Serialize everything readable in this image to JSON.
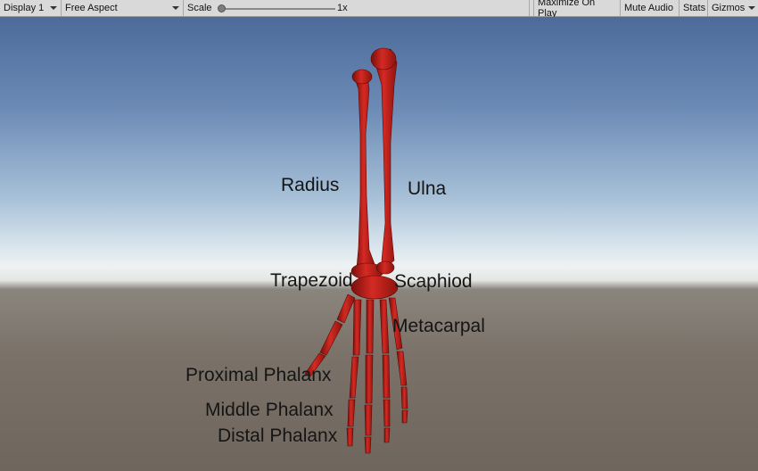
{
  "toolbar": {
    "display": "Display 1",
    "aspect": "Free Aspect",
    "scale_label": "Scale",
    "scale_value": "1x",
    "maximize": "Maximize On Play",
    "mute": "Mute Audio",
    "stats": "Stats",
    "gizmos": "Gizmos"
  },
  "labels": {
    "radius": "Radius",
    "ulna": "Ulna",
    "trapezoid": "Trapezoid",
    "scaphiod": "Scaphiod",
    "metacarpal": "Metacarpal",
    "proximal": "Proximal Phalanx",
    "middle": "Middle Phalanx",
    "distal": "Distal Phalanx"
  },
  "colors": {
    "bone": "#c4201b",
    "sky_top": "#4d6b9a",
    "ground": "#7a7168"
  }
}
